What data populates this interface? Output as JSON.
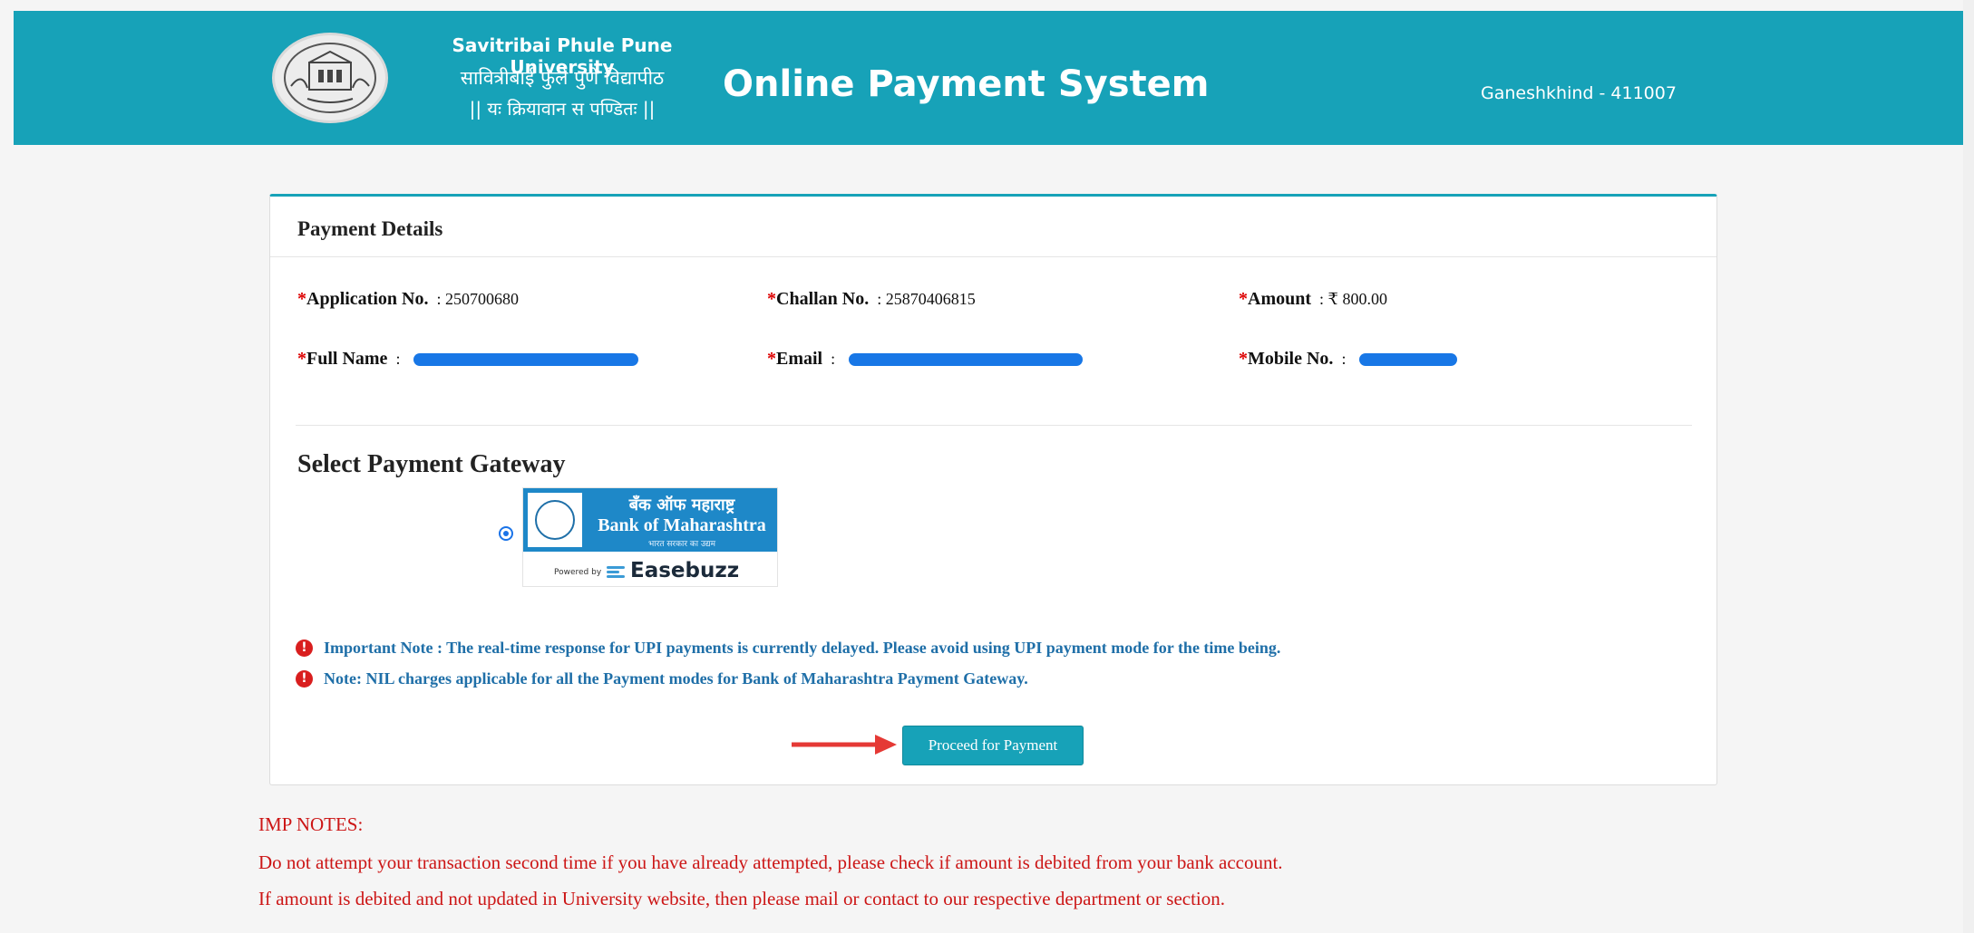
{
  "header": {
    "university_name": "Savitribai Phule Pune University",
    "university_name_mr": "सावित्रीबाई फुले पुणे विद्यापीठ",
    "motto": "|| यः क्रियावान स पण्डितः ||",
    "system_title": "Online Payment System",
    "location": "Ganeshkhind - 411007"
  },
  "payment": {
    "title": "Payment Details",
    "application_label": "Application No.",
    "application_value": ": 250700680",
    "challan_label": "Challan No.",
    "challan_value": ": 25870406815",
    "amount_label": "Amount",
    "amount_value": ": ₹ 800.00",
    "fullname_label": "Full Name",
    "fullname_sep": ":",
    "email_label": "Email",
    "email_sep": ":",
    "mobile_label": "Mobile No.",
    "mobile_sep": ":",
    "required_mark": "*"
  },
  "gateway": {
    "title": "Select Payment Gateway",
    "bank_name_mr": "बँक ऑफ महाराष्ट्र",
    "bank_name_en": "Bank of Maharashtra",
    "bank_tagline": "भारत सरकार का उद्यम",
    "powered_by": "Powered by",
    "provider": "Easebuzz",
    "selected": true
  },
  "notes": [
    "Important Note : The real-time response for UPI payments is currently delayed. Please avoid using UPI payment mode for the time being.",
    "Note: NIL charges applicable for all the Payment modes for Bank of Maharashtra Payment Gateway."
  ],
  "proceed_label": "Proceed for Payment",
  "imp_notes": {
    "heading": "IMP NOTES:",
    "lines": [
      "Do not attempt your transaction second time if you have already attempted, please check if amount is debited from your bank account.",
      "If amount is debited and not updated in University website, then please mail or contact to our respective department or section."
    ]
  },
  "colors": {
    "header_bg": "#17a2b8",
    "note_text": "#1f6fa8",
    "imp_text": "#cc1616",
    "annotation_arrow": "#e53935",
    "redaction": "#1877e6"
  },
  "icons": [
    "university-logo",
    "info-icon",
    "radio-selected",
    "annotation-arrow"
  ]
}
